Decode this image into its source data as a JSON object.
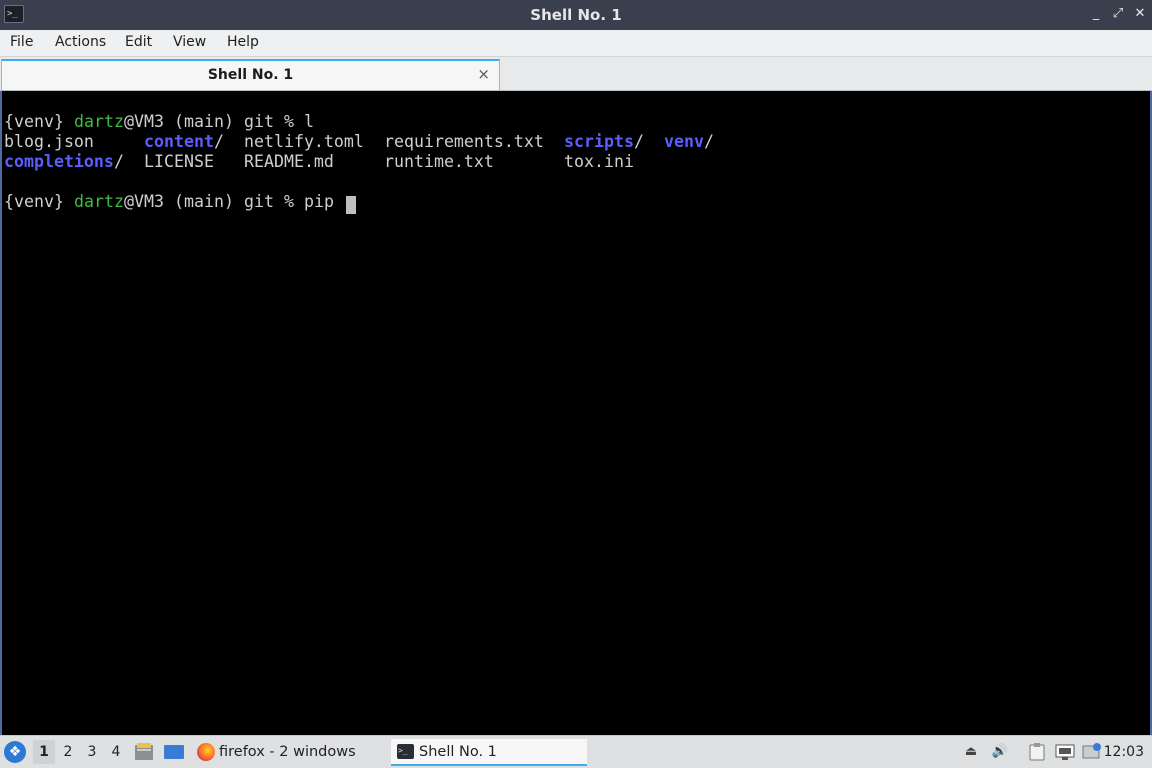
{
  "window": {
    "title": "Shell No. 1",
    "app_icon": "terminal-icon",
    "controls": [
      "minimize-icon",
      "restore-icon",
      "close-icon"
    ]
  },
  "menu": {
    "items": [
      "File",
      "Actions",
      "Edit",
      "View",
      "Help"
    ]
  },
  "tabs": [
    {
      "label": "Shell No. 1",
      "close": "×"
    }
  ],
  "terminal": {
    "prompt1": {
      "venv": "{venv}",
      "user": "dartz",
      "host": "@VM3",
      "branch": "(main)",
      "dir": "git",
      "sigil": "%",
      "command": "l"
    },
    "listing_row1": {
      "c1": "blog.json",
      "c2_dir": "content",
      "c2_slash": "/",
      "c3": "netlify.toml",
      "c4": "requirements.txt",
      "c5_dir": "scripts",
      "c5_slash": "/",
      "c6_dir": "venv",
      "c6_slash": "/"
    },
    "listing_row2": {
      "c1_dir": "completions",
      "c1_slash": "/",
      "c2": "LICENSE",
      "c3": "README.md",
      "c4": "runtime.txt",
      "c5": "tox.ini"
    },
    "prompt2": {
      "venv": "{venv}",
      "user": "dartz",
      "host": "@VM3",
      "branch": "(main)",
      "dir": "git",
      "sigil": "%",
      "command": "pip"
    }
  },
  "taskbar": {
    "workspaces": [
      "1",
      "2",
      "3",
      "4"
    ],
    "active_workspace": "1",
    "quicklaunch": [
      "file-manager-icon",
      "desktop-icon"
    ],
    "tasks": [
      {
        "label": "firefox - 2 windows",
        "icon": "firefox-icon"
      },
      {
        "label": "Shell No. 1",
        "icon": "terminal-icon"
      }
    ],
    "tray": [
      "eject-icon",
      "volume-icon",
      "clipboard-icon",
      "network-icon",
      "notification-icon"
    ],
    "clock": "12:03"
  },
  "colors": {
    "titlebar": "#3a3f4d",
    "terminal_bg": "#000000",
    "prompt_green": "#3fbb43",
    "dir_blue": "#5c5cff",
    "accent": "#3daee9"
  }
}
